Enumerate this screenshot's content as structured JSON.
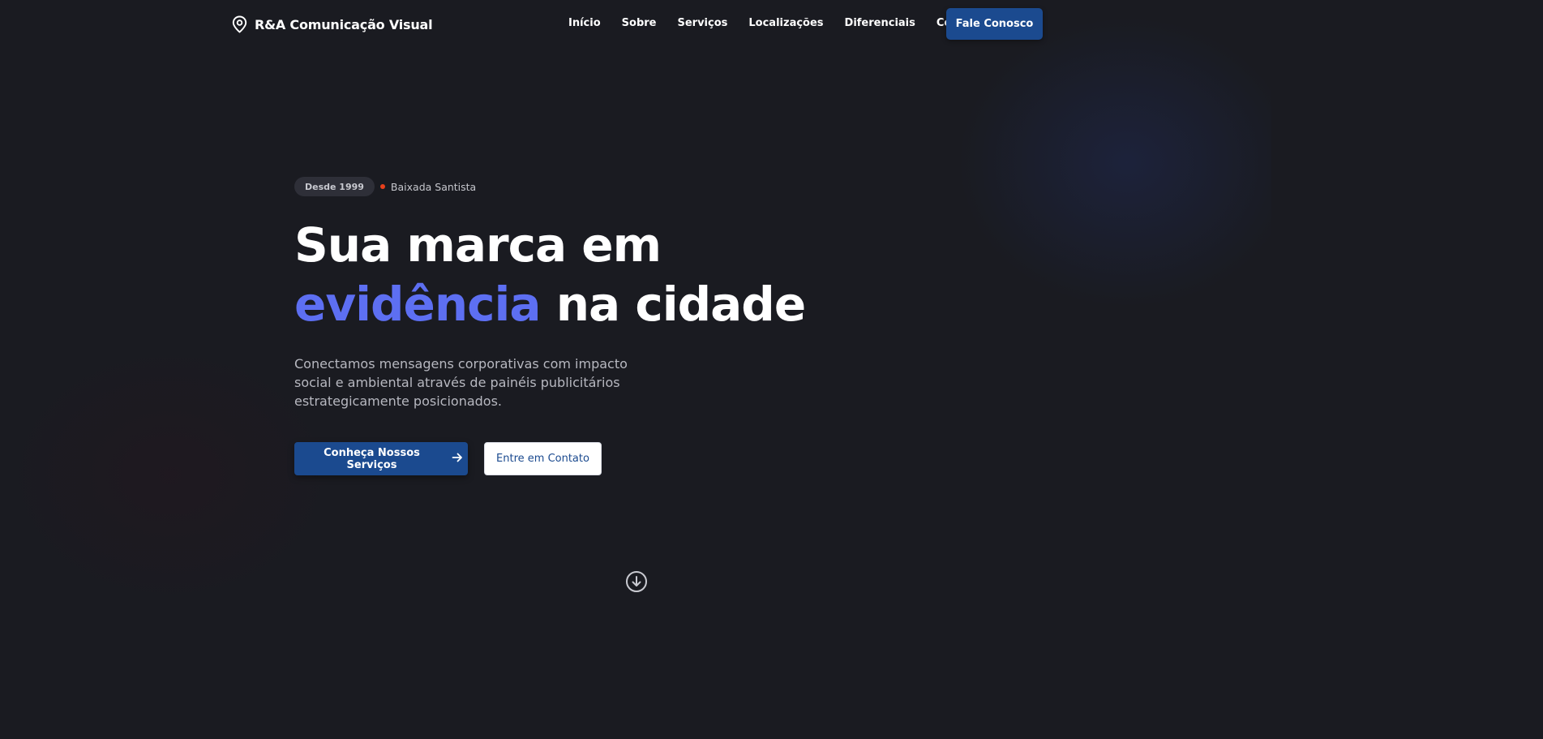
{
  "nav": {
    "brand_icon": "map-pin-icon",
    "brand_name": "R&A Comunicação Visual",
    "links": [
      {
        "label": "Início"
      },
      {
        "label": "Sobre"
      },
      {
        "label": "Serviços"
      },
      {
        "label": "Localizações"
      },
      {
        "label": "Diferenciais"
      },
      {
        "label": "Contato"
      }
    ],
    "cta_label": "Fale Conosco"
  },
  "hero": {
    "badge": "Desde 1999",
    "location": "Baixada Santista",
    "headline_line1": "Sua marca em",
    "headline_accent": "evidência",
    "headline_rest": " na cidade",
    "subtitle": "Conectamos mensagens corporativas com impacto social e ambiental através de painéis publicitários estrategicamente posicionados.",
    "primary_button": "Conheça Nossos Serviços",
    "primary_button_icon": "arrow-right-icon",
    "secondary_button": "Entre em Contato",
    "scroll_icon": "arrow-down-circle-icon"
  },
  "colors": {
    "background": "#1a1b21",
    "primary": "#1b4a8f",
    "accent": "#5d6ff2",
    "dot": "#e8401c"
  }
}
